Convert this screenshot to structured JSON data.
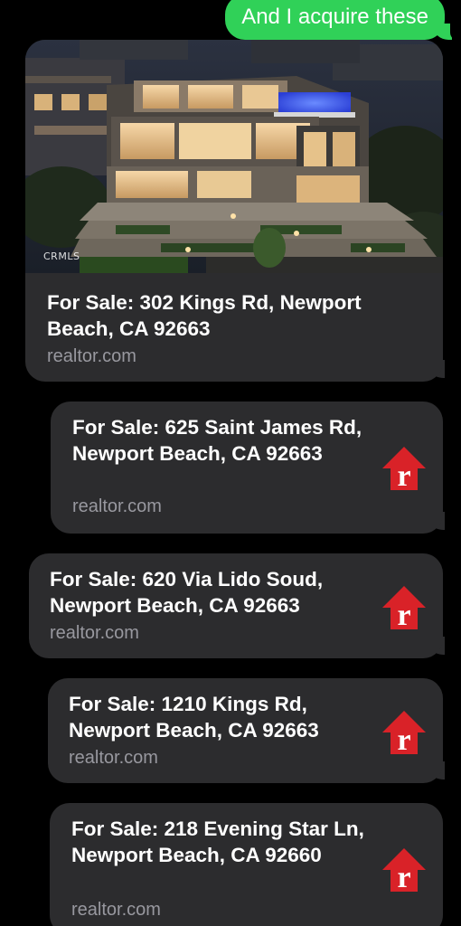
{
  "sent_message": {
    "text": "And I acquire these",
    "color": "#30d158"
  },
  "link_previews": [
    {
      "title": "For Sale: 302 Kings Rd, Newport Beach, CA 92663",
      "domain": "realtor.com",
      "has_image": true,
      "image_watermark": "CRMLS"
    },
    {
      "title": "For Sale: 625 Saint James Rd, Newport Beach, CA 92663",
      "domain": "realtor.com",
      "icon": "realtor-logo-icon"
    },
    {
      "title": "For Sale: 620 Via Lido Soud, Newport Beach, CA 92663",
      "domain": "realtor.com",
      "icon": "realtor-logo-icon"
    },
    {
      "title": "For Sale: 1210 Kings Rd, Newport Beach, CA 92663",
      "domain": "realtor.com",
      "icon": "realtor-logo-icon"
    },
    {
      "title": "For Sale: 218 Evening Star Ln, Newport Beach, CA 92660",
      "domain": "realtor.com",
      "icon": "realtor-logo-icon"
    }
  ],
  "colors": {
    "background": "#000000",
    "received_bubble": "#2c2c2e",
    "domain_text": "#98989f",
    "realtor_red": "#d92228"
  }
}
